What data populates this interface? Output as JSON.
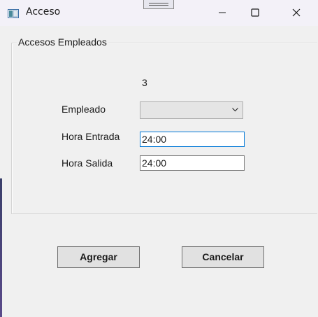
{
  "window": {
    "title": "Acceso"
  },
  "icons": {
    "app": "app-window-icon",
    "minimize": "minimize-icon",
    "maximize": "maximize-icon",
    "close": "close-icon",
    "dropdown": "chevron-down-icon",
    "drag_handle": "drag-handle-icon"
  },
  "group": {
    "title": "Accesos Empleados",
    "id_value": "3"
  },
  "form": {
    "empleado_label": "Empleado",
    "empleado_selected": "",
    "hora_entrada_label": "Hora Entrada",
    "hora_entrada_value": "24:00",
    "hora_salida_label": "Hora Salida",
    "hora_salida_value": "24:00"
  },
  "buttons": {
    "agregar_label": "Agregar",
    "cancelar_label": "Cancelar"
  },
  "colors": {
    "background": "#f0f0f0",
    "titlebar": "#f3f1f8",
    "focus_border": "#0078d7"
  }
}
